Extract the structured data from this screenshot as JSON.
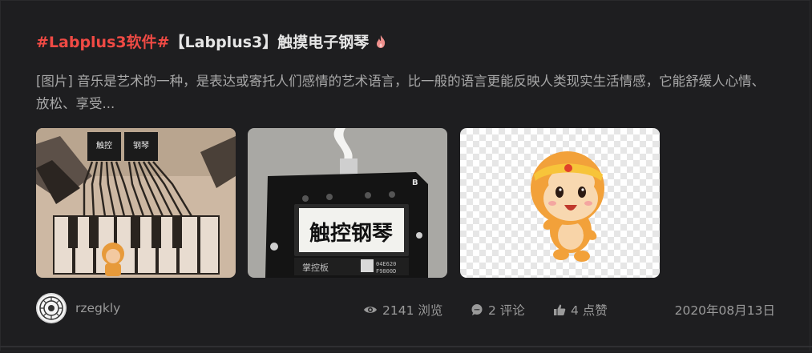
{
  "post": {
    "title_tag": "#Labplus3软件#",
    "title_text": "【Labplus3】触摸电子钢琴",
    "summary": "[图片] 音乐是艺术的一种，是表达或寄托人们感情的艺术语言，比一般的语言更能反映人类现实生活情感，它能舒缓人心情、放松、享受...",
    "images": [
      {
        "icon": "piano-board-photo",
        "chip_labels": [
          "触控",
          "钢琴"
        ]
      },
      {
        "icon": "display-board-photo",
        "screen_text": "触控钢琴",
        "brand_text": "掌控板",
        "board_id_1": "04E620",
        "board_id_2": "F9800D",
        "corner_mark": "B"
      },
      {
        "icon": "monkey-cartoon"
      }
    ]
  },
  "footer": {
    "username": "rzegkly",
    "views": "2141 浏览",
    "comments": "2 评论",
    "likes": "4 点赞",
    "date": "2020年08月13日"
  },
  "colors": {
    "background": "#1e1e20",
    "accent_tag": "#f04a44",
    "fire_icon": "#ee8f8c"
  }
}
